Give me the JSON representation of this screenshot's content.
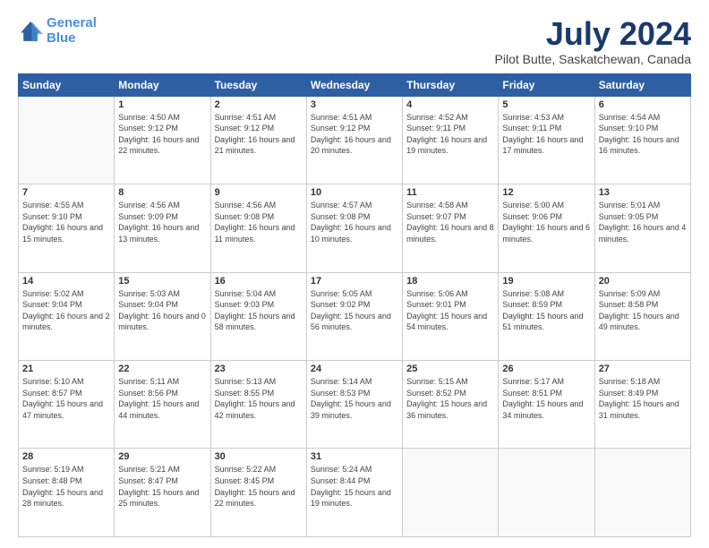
{
  "header": {
    "logo_line1": "General",
    "logo_line2": "Blue",
    "title": "July 2024",
    "subtitle": "Pilot Butte, Saskatchewan, Canada"
  },
  "weekdays": [
    "Sunday",
    "Monday",
    "Tuesday",
    "Wednesday",
    "Thursday",
    "Friday",
    "Saturday"
  ],
  "weeks": [
    [
      {
        "day": "",
        "sunrise": "",
        "sunset": "",
        "daylight": ""
      },
      {
        "day": "1",
        "sunrise": "Sunrise: 4:50 AM",
        "sunset": "Sunset: 9:12 PM",
        "daylight": "Daylight: 16 hours and 22 minutes."
      },
      {
        "day": "2",
        "sunrise": "Sunrise: 4:51 AM",
        "sunset": "Sunset: 9:12 PM",
        "daylight": "Daylight: 16 hours and 21 minutes."
      },
      {
        "day": "3",
        "sunrise": "Sunrise: 4:51 AM",
        "sunset": "Sunset: 9:12 PM",
        "daylight": "Daylight: 16 hours and 20 minutes."
      },
      {
        "day": "4",
        "sunrise": "Sunrise: 4:52 AM",
        "sunset": "Sunset: 9:11 PM",
        "daylight": "Daylight: 16 hours and 19 minutes."
      },
      {
        "day": "5",
        "sunrise": "Sunrise: 4:53 AM",
        "sunset": "Sunset: 9:11 PM",
        "daylight": "Daylight: 16 hours and 17 minutes."
      },
      {
        "day": "6",
        "sunrise": "Sunrise: 4:54 AM",
        "sunset": "Sunset: 9:10 PM",
        "daylight": "Daylight: 16 hours and 16 minutes."
      }
    ],
    [
      {
        "day": "7",
        "sunrise": "Sunrise: 4:55 AM",
        "sunset": "Sunset: 9:10 PM",
        "daylight": "Daylight: 16 hours and 15 minutes."
      },
      {
        "day": "8",
        "sunrise": "Sunrise: 4:56 AM",
        "sunset": "Sunset: 9:09 PM",
        "daylight": "Daylight: 16 hours and 13 minutes."
      },
      {
        "day": "9",
        "sunrise": "Sunrise: 4:56 AM",
        "sunset": "Sunset: 9:08 PM",
        "daylight": "Daylight: 16 hours and 11 minutes."
      },
      {
        "day": "10",
        "sunrise": "Sunrise: 4:57 AM",
        "sunset": "Sunset: 9:08 PM",
        "daylight": "Daylight: 16 hours and 10 minutes."
      },
      {
        "day": "11",
        "sunrise": "Sunrise: 4:58 AM",
        "sunset": "Sunset: 9:07 PM",
        "daylight": "Daylight: 16 hours and 8 minutes."
      },
      {
        "day": "12",
        "sunrise": "Sunrise: 5:00 AM",
        "sunset": "Sunset: 9:06 PM",
        "daylight": "Daylight: 16 hours and 6 minutes."
      },
      {
        "day": "13",
        "sunrise": "Sunrise: 5:01 AM",
        "sunset": "Sunset: 9:05 PM",
        "daylight": "Daylight: 16 hours and 4 minutes."
      }
    ],
    [
      {
        "day": "14",
        "sunrise": "Sunrise: 5:02 AM",
        "sunset": "Sunset: 9:04 PM",
        "daylight": "Daylight: 16 hours and 2 minutes."
      },
      {
        "day": "15",
        "sunrise": "Sunrise: 5:03 AM",
        "sunset": "Sunset: 9:04 PM",
        "daylight": "Daylight: 16 hours and 0 minutes."
      },
      {
        "day": "16",
        "sunrise": "Sunrise: 5:04 AM",
        "sunset": "Sunset: 9:03 PM",
        "daylight": "Daylight: 15 hours and 58 minutes."
      },
      {
        "day": "17",
        "sunrise": "Sunrise: 5:05 AM",
        "sunset": "Sunset: 9:02 PM",
        "daylight": "Daylight: 15 hours and 56 minutes."
      },
      {
        "day": "18",
        "sunrise": "Sunrise: 5:06 AM",
        "sunset": "Sunset: 9:01 PM",
        "daylight": "Daylight: 15 hours and 54 minutes."
      },
      {
        "day": "19",
        "sunrise": "Sunrise: 5:08 AM",
        "sunset": "Sunset: 8:59 PM",
        "daylight": "Daylight: 15 hours and 51 minutes."
      },
      {
        "day": "20",
        "sunrise": "Sunrise: 5:09 AM",
        "sunset": "Sunset: 8:58 PM",
        "daylight": "Daylight: 15 hours and 49 minutes."
      }
    ],
    [
      {
        "day": "21",
        "sunrise": "Sunrise: 5:10 AM",
        "sunset": "Sunset: 8:57 PM",
        "daylight": "Daylight: 15 hours and 47 minutes."
      },
      {
        "day": "22",
        "sunrise": "Sunrise: 5:11 AM",
        "sunset": "Sunset: 8:56 PM",
        "daylight": "Daylight: 15 hours and 44 minutes."
      },
      {
        "day": "23",
        "sunrise": "Sunrise: 5:13 AM",
        "sunset": "Sunset: 8:55 PM",
        "daylight": "Daylight: 15 hours and 42 minutes."
      },
      {
        "day": "24",
        "sunrise": "Sunrise: 5:14 AM",
        "sunset": "Sunset: 8:53 PM",
        "daylight": "Daylight: 15 hours and 39 minutes."
      },
      {
        "day": "25",
        "sunrise": "Sunrise: 5:15 AM",
        "sunset": "Sunset: 8:52 PM",
        "daylight": "Daylight: 15 hours and 36 minutes."
      },
      {
        "day": "26",
        "sunrise": "Sunrise: 5:17 AM",
        "sunset": "Sunset: 8:51 PM",
        "daylight": "Daylight: 15 hours and 34 minutes."
      },
      {
        "day": "27",
        "sunrise": "Sunrise: 5:18 AM",
        "sunset": "Sunset: 8:49 PM",
        "daylight": "Daylight: 15 hours and 31 minutes."
      }
    ],
    [
      {
        "day": "28",
        "sunrise": "Sunrise: 5:19 AM",
        "sunset": "Sunset: 8:48 PM",
        "daylight": "Daylight: 15 hours and 28 minutes."
      },
      {
        "day": "29",
        "sunrise": "Sunrise: 5:21 AM",
        "sunset": "Sunset: 8:47 PM",
        "daylight": "Daylight: 15 hours and 25 minutes."
      },
      {
        "day": "30",
        "sunrise": "Sunrise: 5:22 AM",
        "sunset": "Sunset: 8:45 PM",
        "daylight": "Daylight: 15 hours and 22 minutes."
      },
      {
        "day": "31",
        "sunrise": "Sunrise: 5:24 AM",
        "sunset": "Sunset: 8:44 PM",
        "daylight": "Daylight: 15 hours and 19 minutes."
      },
      {
        "day": "",
        "sunrise": "",
        "sunset": "",
        "daylight": ""
      },
      {
        "day": "",
        "sunrise": "",
        "sunset": "",
        "daylight": ""
      },
      {
        "day": "",
        "sunrise": "",
        "sunset": "",
        "daylight": ""
      }
    ]
  ]
}
